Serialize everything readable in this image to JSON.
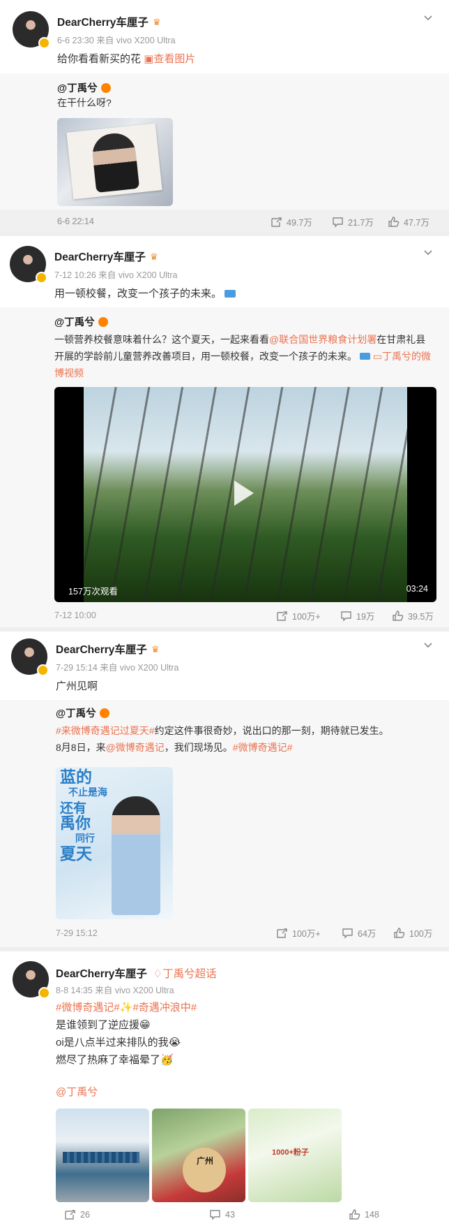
{
  "posts": [
    {
      "author": "DearCherry车厘子",
      "meta": "6-6 23:30 来自 vivo X200 Ultra",
      "text": "给你看看新买的花",
      "link_text": "查看图片",
      "quote": {
        "author": "@丁禹兮",
        "text": "在干什么呀?",
        "time": "6-6 22:14",
        "reposts": "49.7万",
        "comments": "21.7万",
        "likes": "47.7万"
      }
    },
    {
      "author": "DearCherry车厘子",
      "meta": "7-12 10:26 来自 vivo X200 Ultra",
      "text": "用一顿校餐，改变一个孩子的未来。",
      "quote": {
        "author": "@丁禹兮",
        "text_line1_a": "一顿营养校餐意味着什么？这个夏天，一起来看看",
        "text_mention": "@联合国世界粮食计划署",
        "text_line1_b": "在甘肃礼县",
        "text_line2": "开展的学龄前儿童营养改善项目，用一顿校餐，改变一个孩子的未来。",
        "text_link": "丁禹兮的微",
        "text_link2": "博视频",
        "video_views": "157万次观看",
        "video_duration": "03:24",
        "time": "7-12 10:00",
        "reposts": "100万+",
        "comments": "19万",
        "likes": "39.5万"
      }
    },
    {
      "author": "DearCherry车厘子",
      "meta": "7-29 15:14 来自 vivo X200 Ultra",
      "text": "广州见啊",
      "quote": {
        "author": "@丁禹兮",
        "hashtag1": "#来微博奇遇记过夏天#",
        "text1": "约定这件事很奇妙，说出口的那一刻，期待就已发生。",
        "text2a": "8月8日，来",
        "mention": "@微博奇遇记",
        "text2b": "，我们现场见。",
        "hashtag2": "#微博奇遇记#",
        "poster_text": [
          "蓝的",
          "不止是海",
          "还有",
          "禹你",
          "同行",
          "夏天"
        ],
        "time": "7-29 15:12",
        "reposts": "100万+",
        "comments": "64万",
        "likes": "100万"
      }
    },
    {
      "author": "DearCherry车厘子",
      "super_topic": "丁禹兮超话",
      "meta": "8-8 14:35 来自 vivo X200 Ultra",
      "hashtags": "#微博奇遇记#",
      "hashtag2": "#奇遇冲浪中#",
      "line2": "是谁领到了逆应援😁",
      "line3": "oi是八点半过来排队的我😭",
      "line4": "燃尽了热麻了幸福晕了🥳",
      "mention": "@丁禹兮",
      "thumb2_text": "广州",
      "thumb3_text": "1000+粉子",
      "reposts": "26",
      "comments": "43",
      "likes": "148"
    }
  ],
  "colors": {
    "accent": "#eb7350",
    "vip": "#f5b400",
    "verified_orange": "#ff8200"
  }
}
